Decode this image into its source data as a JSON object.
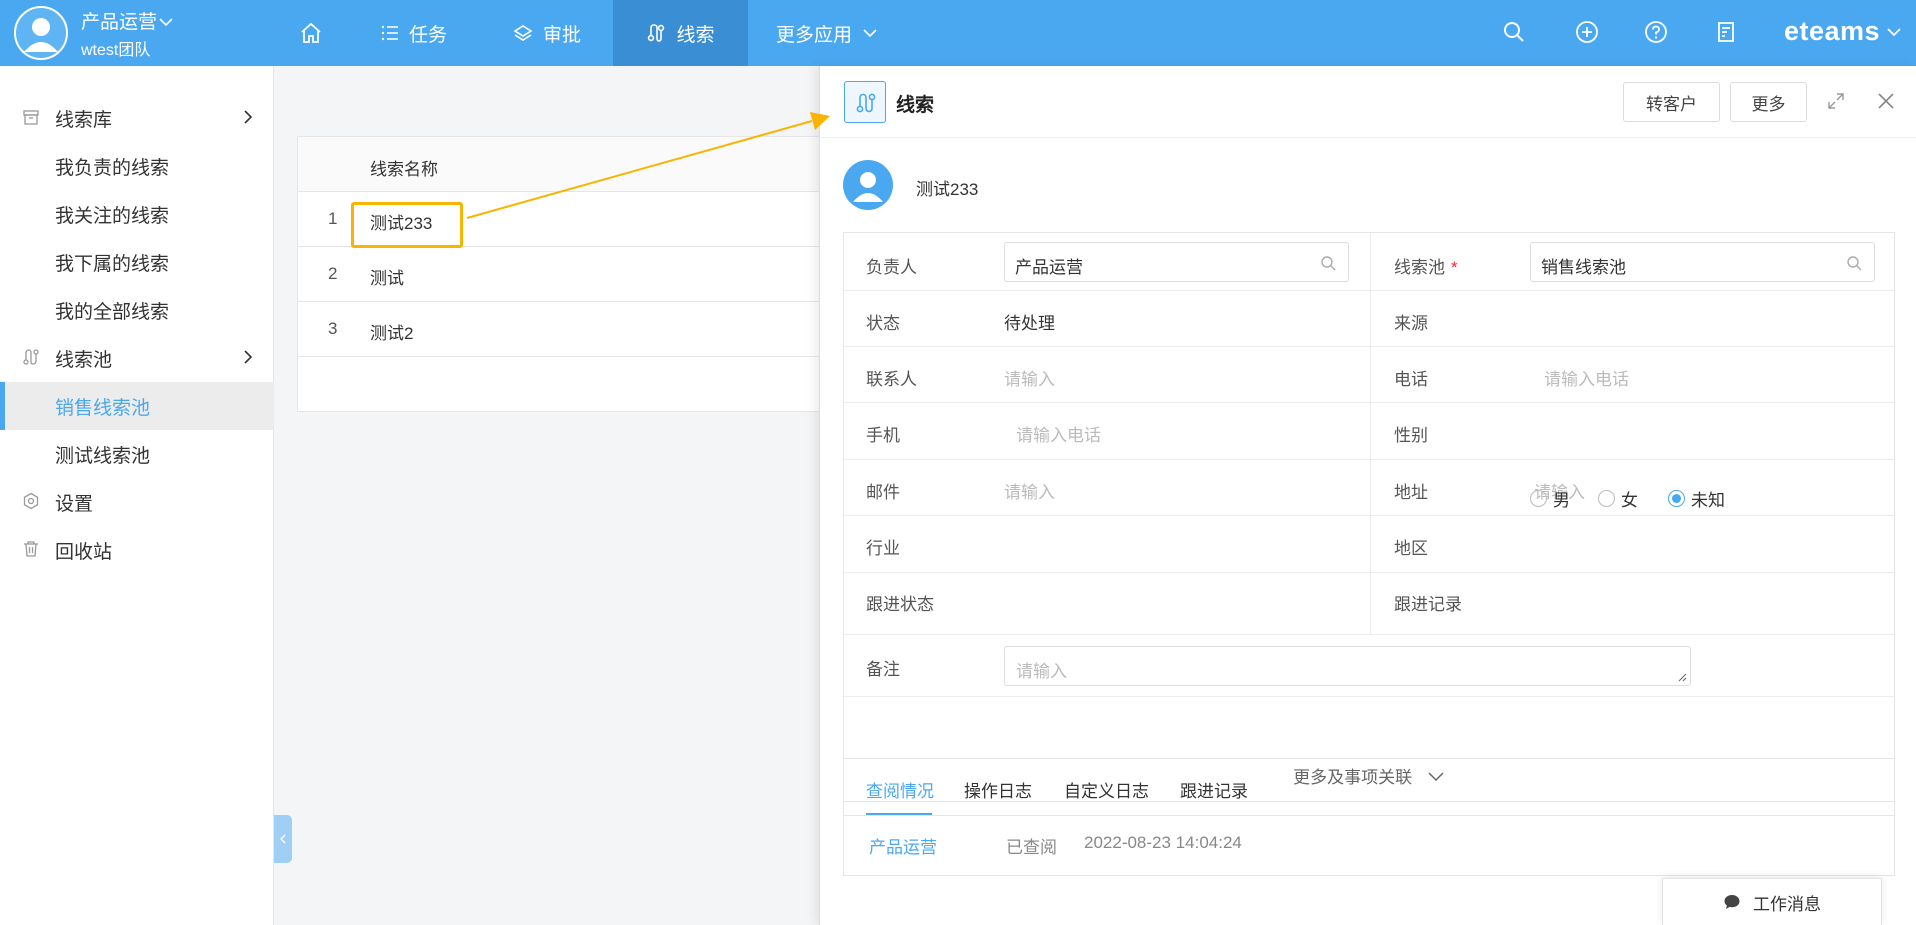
{
  "topbar": {
    "user_name": "产品运营",
    "team": "wtest团队",
    "nav": [
      {
        "label": "任务"
      },
      {
        "label": "审批"
      },
      {
        "label": "线索"
      },
      {
        "label": "更多应用"
      }
    ],
    "brand": "eteams",
    "accent_color": "#4aa8f0"
  },
  "sidebar": {
    "items": [
      {
        "label": "线索库",
        "icon": "box-icon"
      },
      {
        "label": "我负责的线索"
      },
      {
        "label": "我关注的线索"
      },
      {
        "label": "我下属的线索"
      },
      {
        "label": "我的全部线索"
      },
      {
        "label": "线索池",
        "icon": "pool-icon"
      },
      {
        "label": "销售线索池",
        "active": true
      },
      {
        "label": "测试线索池"
      },
      {
        "label": "设置",
        "icon": "settings-icon"
      },
      {
        "label": "回收站",
        "icon": "trash-icon"
      }
    ]
  },
  "list": {
    "column_header": "线索名称",
    "rows": [
      {
        "num": "1",
        "name": "测试233"
      },
      {
        "num": "2",
        "name": "测试"
      },
      {
        "num": "3",
        "name": "测试2"
      }
    ]
  },
  "panel": {
    "title": "线索",
    "convert_button": "转客户",
    "more_button": "更多",
    "lead_name": "测试233",
    "fields": {
      "owner_label": "负责人",
      "owner_value": "产品运营",
      "pool_label": "线索池",
      "pool_required": "*",
      "pool_value": "销售线索池",
      "status_label": "状态",
      "status_value": "待处理",
      "source_label": "来源",
      "contact_label": "联系人",
      "contact_placeholder": "请输入",
      "phone_label": "电话",
      "phone_placeholder": "请输入电话",
      "mobile_label": "手机",
      "mobile_placeholder": "请输入电话",
      "gender_label": "性别",
      "gender_options": [
        "男",
        "女",
        "未知"
      ],
      "gender_selected": "未知",
      "email_label": "邮件",
      "email_placeholder": "请输入",
      "address_label": "地址",
      "address_placeholder": "请输入",
      "industry_label": "行业",
      "region_label": "地区",
      "follow_status_label": "跟进状态",
      "follow_record_label": "跟进记录",
      "remark_label": "备注",
      "remark_placeholder": "请输入"
    },
    "more_link": "更多及事项关联",
    "tabs": [
      {
        "label": "查阅情况",
        "active": true
      },
      {
        "label": "操作日志"
      },
      {
        "label": "自定义日志"
      },
      {
        "label": "跟进记录"
      }
    ],
    "log": {
      "user": "产品运营",
      "status": "已查阅",
      "time": "2022-08-23 14:04:24"
    }
  },
  "work_message": "工作消息",
  "highlight_color": "#f8b400"
}
